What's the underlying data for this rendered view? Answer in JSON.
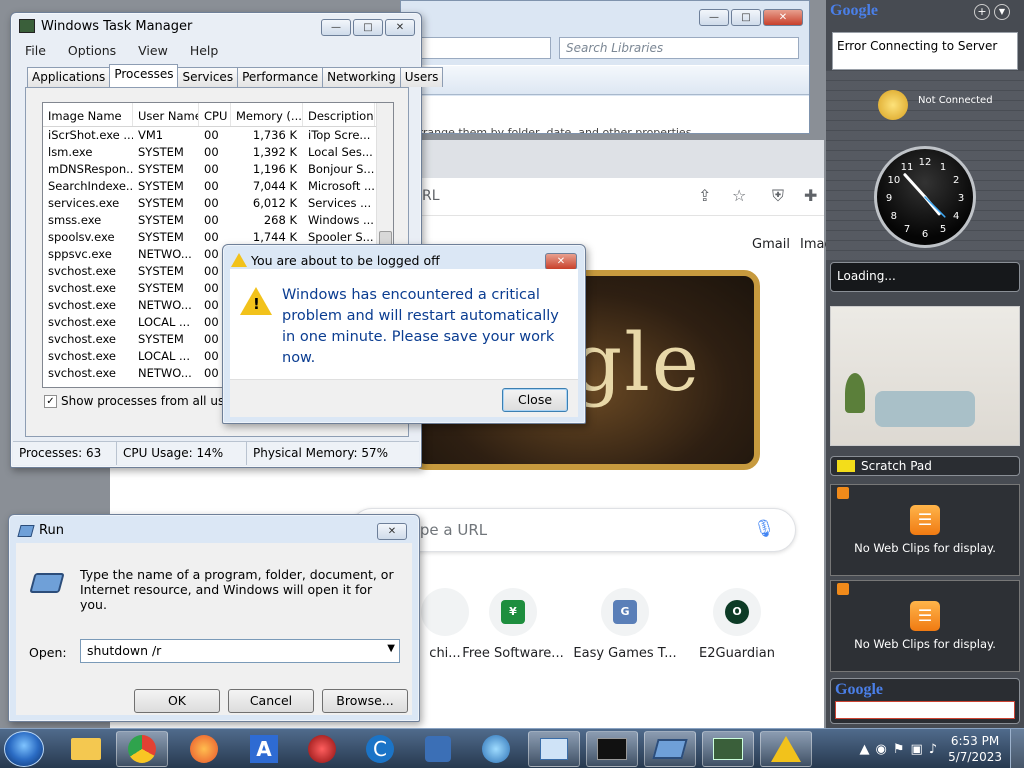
{
  "explorer": {
    "search_placeholder": "Search Libraries",
    "content_text": "Arrange them by folder, date, and other properties."
  },
  "browser": {
    "url_placeholder": "RL",
    "gmail": "Gmail",
    "images": "Images",
    "doodle_text": "gle",
    "search_placeholder": "ype a URL",
    "shortcuts": [
      {
        "label": "chi...",
        "chip": "",
        "color": "#cccccc"
      },
      {
        "label": "Free Software...",
        "chip": "¥",
        "color": "#1e8e3e"
      },
      {
        "label": "Easy Games T...",
        "chip": "G",
        "color": "#5a7fb8"
      },
      {
        "label": "E2Guardian",
        "chip": "O",
        "color": "#0d3b26"
      }
    ]
  },
  "taskman": {
    "title": "Windows Task Manager",
    "menu": [
      "File",
      "Options",
      "View",
      "Help"
    ],
    "tabs": [
      "Applications",
      "Processes",
      "Services",
      "Performance",
      "Networking",
      "Users"
    ],
    "active_tab": "Processes",
    "columns": [
      "Image Name",
      "User Name",
      "CPU",
      "Memory (...",
      "Description"
    ],
    "rows": [
      [
        "iScrShot.exe ...",
        "VM1",
        "00",
        "1,736 K",
        "iTop Scre..."
      ],
      [
        "lsm.exe",
        "SYSTEM",
        "00",
        "1,392 K",
        "Local Ses..."
      ],
      [
        "mDNSRespon...",
        "SYSTEM",
        "00",
        "1,196 K",
        "Bonjour S..."
      ],
      [
        "SearchIndexe...",
        "SYSTEM",
        "00",
        "7,044 K",
        "Microsoft ..."
      ],
      [
        "services.exe",
        "SYSTEM",
        "00",
        "6,012 K",
        "Services ..."
      ],
      [
        "smss.exe",
        "SYSTEM",
        "00",
        "268 K",
        "Windows ..."
      ],
      [
        "spoolsv.exe",
        "SYSTEM",
        "00",
        "1,744 K",
        "Spooler S..."
      ],
      [
        "sppsvc.exe",
        "NETWO...",
        "00",
        "",
        ""
      ],
      [
        "svchost.exe",
        "SYSTEM",
        "00",
        "",
        ""
      ],
      [
        "svchost.exe",
        "SYSTEM",
        "00",
        "",
        ""
      ],
      [
        "svchost.exe",
        "NETWO...",
        "00",
        "",
        ""
      ],
      [
        "svchost.exe",
        "LOCAL ...",
        "00",
        "",
        ""
      ],
      [
        "svchost.exe",
        "SYSTEM",
        "00",
        "",
        ""
      ],
      [
        "svchost.exe",
        "LOCAL ...",
        "00",
        "",
        ""
      ],
      [
        "svchost.exe",
        "NETWO...",
        "00",
        "",
        ""
      ]
    ],
    "show_all_label": "Show processes from all users",
    "status": {
      "processes": "Processes: 63",
      "cpu": "CPU Usage: 14%",
      "memory": "Physical Memory: 57%"
    }
  },
  "logoff": {
    "title": "You are about to be logged off",
    "message": "Windows has encountered a critical problem and will restart automatically in one minute. Please save your work now.",
    "close_label": "Close"
  },
  "run": {
    "title": "Run",
    "description": "Type the name of a program, folder, document, or Internet resource, and Windows will open it for you.",
    "open_label": "Open:",
    "command": "shutdown /r",
    "ok_label": "OK",
    "cancel_label": "Cancel",
    "browse_label": "Browse..."
  },
  "sidebar": {
    "gadget_logo": "Google",
    "error_text": "Error Connecting to Server",
    "weather_status": "Not Connected",
    "clock_numbers": [
      "12",
      "1",
      "2",
      "3",
      "4",
      "5",
      "6",
      "7",
      "8",
      "9",
      "10",
      "11"
    ],
    "loading_text": "Loading...",
    "scratch_pad": "Scratch Pad",
    "webclip_1": "No Web Clips for display.",
    "webclip_2": "No Web Clips for display."
  },
  "taskbar": {
    "time": "6:53 PM",
    "date": "5/7/2023"
  }
}
